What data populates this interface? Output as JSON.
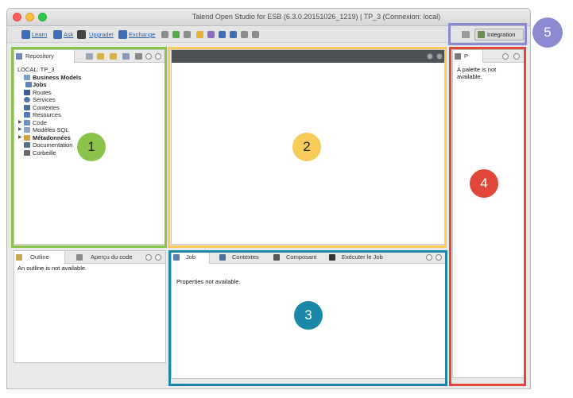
{
  "window": {
    "title": "Talend Open Studio for ESB (6.3.0.20151026_1219) | TP_3 (Connexion: local)"
  },
  "toolbar": {
    "learn": "Learn",
    "ask": "Ask",
    "upgrade": "Upgrade!",
    "exchange": "Exchange",
    "perspective": "Integration"
  },
  "repository": {
    "tab_label": "Repository",
    "local_label": "LOCAL: TP_3",
    "items": [
      {
        "label": "Business Models",
        "bold": true
      },
      {
        "label": "Jobs",
        "bold": true
      },
      {
        "label": "Routes",
        "bold": false
      },
      {
        "label": "Services",
        "bold": false
      },
      {
        "label": "Contextes",
        "bold": false
      },
      {
        "label": "Resources",
        "bold": false
      },
      {
        "label": "Code",
        "bold": false
      },
      {
        "label": "Modèles SQL",
        "bold": false
      },
      {
        "label": "Métadonnées",
        "bold": true
      },
      {
        "label": "Documentation",
        "bold": false
      },
      {
        "label": "Corbeille",
        "bold": false
      }
    ]
  },
  "outline": {
    "tab_outline": "Outline",
    "tab_apercu": "Aperçu du code",
    "message": "An outline is not available."
  },
  "properties": {
    "tabs": [
      "Job",
      "Contextes",
      "Composant",
      "Exécuter le Job"
    ],
    "message": "Properties not available."
  },
  "palette": {
    "tab_label": "P",
    "message": "A palette is not available."
  },
  "annotations": [
    {
      "number": "1",
      "color": "#8bc34a"
    },
    {
      "number": "2",
      "color": "#f7cc5a"
    },
    {
      "number": "3",
      "color": "#1a86a8"
    },
    {
      "number": "4",
      "color": "#e0463a"
    },
    {
      "number": "5",
      "color": "#8a8ad0"
    }
  ]
}
